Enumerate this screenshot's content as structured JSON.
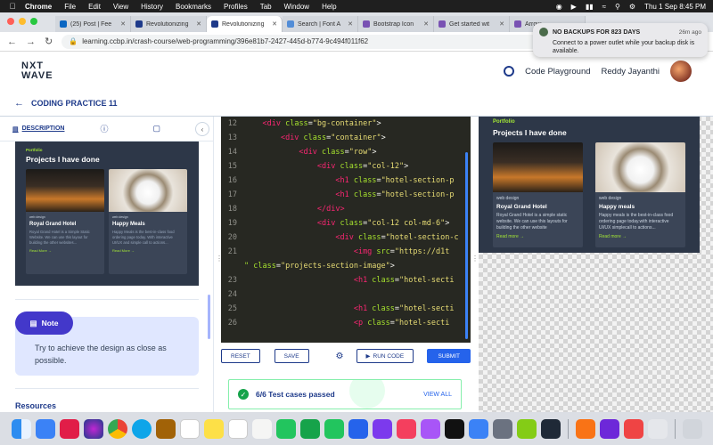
{
  "menubar": {
    "app": "Chrome",
    "items": [
      "File",
      "Edit",
      "View",
      "History",
      "Bookmarks",
      "Profiles",
      "Tab",
      "Window",
      "Help"
    ],
    "clock": "Thu 1 Sep  8:45 PM"
  },
  "browser": {
    "tabs": [
      {
        "title": "(25) Post | Fee",
        "color": "#0a66c2"
      },
      {
        "title": "Revolutionizing",
        "color": "#1e3a8a"
      },
      {
        "title": "Revolutionizing",
        "color": "#1e3a8a",
        "active": true
      },
      {
        "title": "Search | Font A",
        "color": "#528dd7"
      },
      {
        "title": "Bootstrap Icon",
        "color": "#7952b3"
      },
      {
        "title": "Get started wit",
        "color": "#7952b3"
      },
      {
        "title": "Arrow",
        "color": "#7952b3"
      }
    ],
    "url": "learning.ccbp.in/crash-course/web-programming/396e81b7-2427-445d-b774-9c494f011f62"
  },
  "notification": {
    "title": "NO BACKUPS FOR 823 DAYS",
    "time": "26m ago",
    "body": "Connect to a power outlet while your backup disk is available."
  },
  "header": {
    "logo_line1": "NXT",
    "logo_line2": "WAVE",
    "code_playground": "Code Playground",
    "user_name": "Reddy Jayanthi"
  },
  "practice": {
    "title": "CODING PRACTICE 11"
  },
  "left_panel": {
    "tab_description": "DESCRIPTION",
    "note_label": "Note",
    "note_text": "Try to achieve the design as close as possible.",
    "resources": "Resources"
  },
  "portfolio": {
    "label": "Portfolio",
    "heading": "Projects I have done",
    "cards": [
      {
        "tag": "web design",
        "name": "Royal Grand Hotel",
        "desc": "Royal Grand Hotel is a simple static website. We can use this layouts for building the other website",
        "read_more": "Read more →"
      },
      {
        "tag": "web design",
        "name": "Happy meals",
        "desc": "Happy meals is the best-in-class food ordering page today.with interactive UI/UX simplecall to actions...",
        "read_more": "Read more →"
      }
    ],
    "thumb_cards": [
      {
        "tag": "web design",
        "name": "Royal Grand Hotel",
        "desc": "Royal Grand Hotel is a Simple Static Website. We can use this layout for building the other websites...",
        "read_more": "Read More →"
      },
      {
        "tag": "web design",
        "name": "Happy Meals",
        "desc": "Happy Meals is the best-in-class food ordering page today. With interactive UI/UX and simple call to actions...",
        "read_more": "Read More →"
      }
    ]
  },
  "editor": {
    "lines": [
      {
        "n": "12",
        "indent": "    ",
        "tag": "<div",
        "attr": " class",
        "eq": "=",
        "str": "\"bg-container\"",
        "end": ">"
      },
      {
        "n": "13",
        "indent": "        ",
        "tag": "<div",
        "attr": " class",
        "eq": "=",
        "str": "\"container\"",
        "end": ">"
      },
      {
        "n": "14",
        "indent": "            ",
        "tag": "<div",
        "attr": " class",
        "eq": "=",
        "str": "\"row\"",
        "end": ">"
      },
      {
        "n": "15",
        "indent": "                ",
        "tag": "<div",
        "attr": " class",
        "eq": "=",
        "str": "\"col-12\"",
        "end": ">"
      },
      {
        "n": "16",
        "indent": "                    ",
        "tag": "<h1",
        "attr": " class",
        "eq": "=",
        "str": "\"hotel-section-p",
        "end": ""
      },
      {
        "n": "17",
        "indent": "                    ",
        "tag": "<h1",
        "attr": " class",
        "eq": "=",
        "str": "\"hotel-section-p",
        "end": ""
      },
      {
        "n": "18",
        "indent": "                ",
        "tag": "</div>",
        "attr": "",
        "eq": "",
        "str": "",
        "end": ""
      },
      {
        "n": "19",
        "indent": "                ",
        "tag": "<div",
        "attr": " class",
        "eq": "=",
        "str": "\"col-12 col-md-6\"",
        "end": ">"
      },
      {
        "n": "20",
        "indent": "                    ",
        "tag": "<div",
        "attr": " class",
        "eq": "=",
        "str": "\"hotel-section-c",
        "end": ""
      },
      {
        "n": "21",
        "indent": "                        ",
        "tag": "<img",
        "attr": " src",
        "eq": "=",
        "str": "\"https://d1t",
        "end": ""
      },
      {
        "n": "",
        "indent": "",
        "tag": "",
        "attr": "\" class",
        "eq": "=",
        "str": "\"projects-section-image\"",
        "end": ">"
      },
      {
        "n": "23",
        "indent": "                        ",
        "tag": "<h1",
        "attr": " class",
        "eq": "=",
        "str": "\"hotel-secti",
        "end": ""
      },
      {
        "n": "24",
        "indent": "",
        "tag": "",
        "attr": "",
        "eq": "",
        "str": "",
        "end": ""
      },
      {
        "n": "25",
        "indent": "                        ",
        "tag": "<h1",
        "attr": " class",
        "eq": "=",
        "str": "\"hotel-secti",
        "end": ""
      },
      {
        "n": "26",
        "indent": "                        ",
        "tag": "<p",
        "attr": " class",
        "eq": "=",
        "str": "\"hotel-secti",
        "end": ""
      }
    ]
  },
  "toolbar": {
    "reset": "RESET",
    "save": "SAVE",
    "run_code": "RUN CODE",
    "submit": "SUBMIT"
  },
  "tests": {
    "status": "6/6 Test cases passed",
    "view_all": "VIEW ALL"
  },
  "colors": {
    "brand": "#1e3a8a",
    "accent": "#2563eb",
    "note_pill": "#4338ca",
    "portfolio_green": "#a3e635"
  }
}
